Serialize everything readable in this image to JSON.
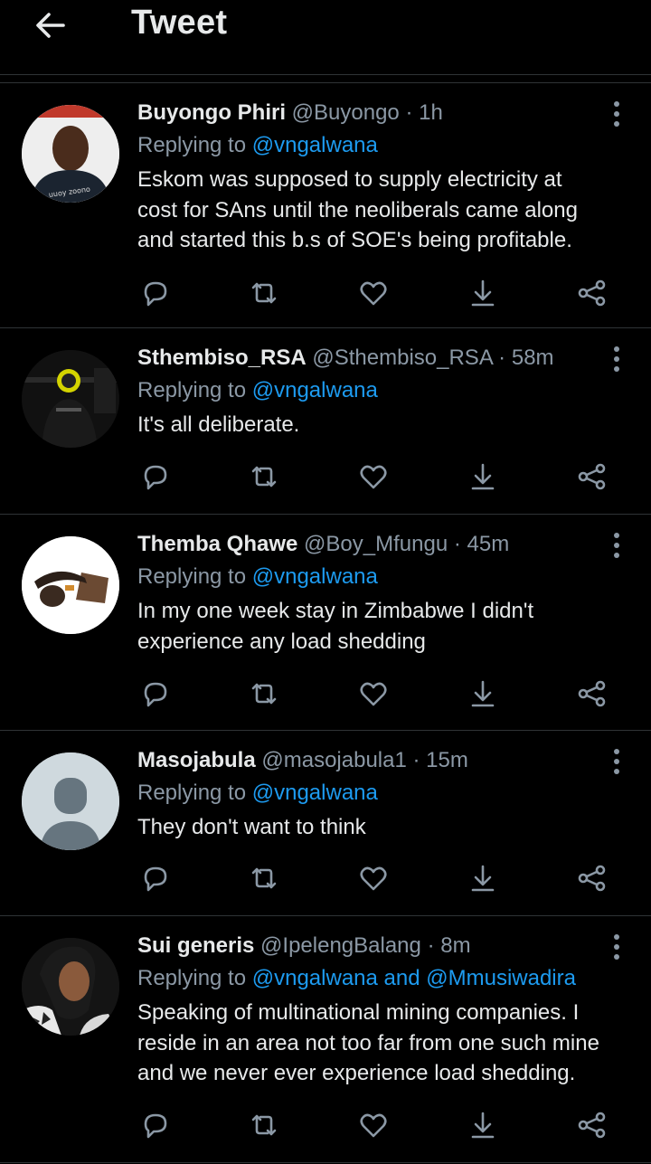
{
  "header": {
    "title": "Tweet"
  },
  "tweets": [
    {
      "name": "Buyongo Phiri",
      "handle": "@Buyongo",
      "dot": "·",
      "time": "1h",
      "replying_prefix": "Replying to ",
      "replying_to": "@vngalwana",
      "lines": [
        "Eskom was supposed to supply electricity at",
        "cost for SAns until the neoliberals came along",
        "and started this b.s of SOE's being profitable."
      ],
      "avatar_shirt_text": "uuoy zoono"
    },
    {
      "name": "Sthembiso_RSA",
      "handle": "@Sthembiso_RSA",
      "dot": "·",
      "time": "58m",
      "replying_prefix": "Replying to ",
      "replying_to": "@vngalwana",
      "lines": [
        "It's all deliberate."
      ]
    },
    {
      "name": "Themba Qhawe",
      "handle": "@Boy_Mfungu",
      "dot": "·",
      "time": "45m",
      "replying_prefix": "Replying to ",
      "replying_to": "@vngalwana",
      "lines": [
        "In my one week stay in Zimbabwe I didn't",
        "experience any load shedding"
      ]
    },
    {
      "name": "Masojabula",
      "handle": "@masojabula1",
      "dot": "·",
      "time": "15m",
      "replying_prefix": "Replying to ",
      "replying_to": "@vngalwana",
      "lines": [
        "They don't want to think"
      ]
    },
    {
      "name": "Sui generis",
      "handle": "@IpelengBalang",
      "dot": "·",
      "time": "8m",
      "replying_prefix": "Replying to ",
      "replying_to": "@vngalwana and @Mmusiwadira",
      "lines": [
        "Speaking of multinational mining companies. I",
        "reside in an area not too far from one such mine",
        "and we never ever experience load shedding."
      ]
    }
  ],
  "icons": {
    "back": "arrow-left-icon",
    "more": "more-vertical-icon",
    "reply": "reply-icon",
    "retweet": "retweet-icon",
    "like": "heart-icon",
    "download": "download-icon",
    "share": "share-icon"
  },
  "colors": {
    "background": "#000000",
    "text": "#e7e9ea",
    "secondary": "#8b98a5",
    "accent": "#1d9bf0",
    "divider": "#2f3336"
  }
}
